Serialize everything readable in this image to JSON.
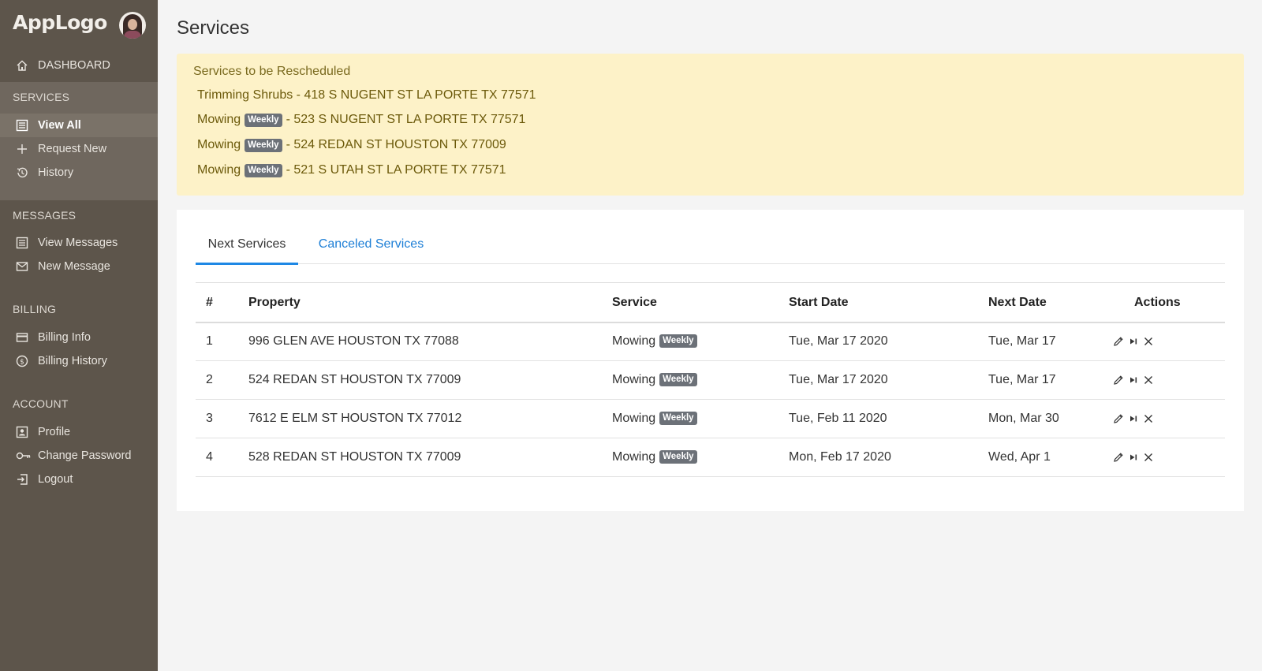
{
  "app": {
    "logo_text": "AppLogo"
  },
  "sidebar": {
    "dashboard": {
      "label": "DASHBOARD",
      "icon": "home-icon"
    },
    "sections": [
      {
        "title": "SERVICES",
        "items": [
          {
            "label": "View All",
            "icon": "list-icon",
            "active": true
          },
          {
            "label": "Request New",
            "icon": "plus-icon"
          },
          {
            "label": "History",
            "icon": "history-icon"
          }
        ]
      },
      {
        "title": "MESSAGES",
        "items": [
          {
            "label": "View Messages",
            "icon": "list-icon"
          },
          {
            "label": "New Message",
            "icon": "mail-icon"
          }
        ]
      },
      {
        "title": "BILLING",
        "items": [
          {
            "label": "Billing Info",
            "icon": "card-icon"
          },
          {
            "label": "Billing History",
            "icon": "dollar-icon"
          }
        ]
      },
      {
        "title": "ACCOUNT",
        "items": [
          {
            "label": "Profile",
            "icon": "profile-icon"
          },
          {
            "label": "Change Password",
            "icon": "key-icon"
          },
          {
            "label": "Logout",
            "icon": "logout-icon"
          }
        ]
      }
    ]
  },
  "main": {
    "title": "Services",
    "alert": {
      "heading": "Services to be Rescheduled",
      "items": [
        {
          "service": "Trimming Shrubs",
          "badge": "",
          "address": "418 S NUGENT ST LA PORTE TX 77571"
        },
        {
          "service": "Mowing",
          "badge": "Weekly",
          "address": "523 S NUGENT ST LA PORTE TX 77571"
        },
        {
          "service": "Mowing",
          "badge": "Weekly",
          "address": "524 REDAN ST HOUSTON TX 77009"
        },
        {
          "service": "Mowing",
          "badge": "Weekly",
          "address": "521 S UTAH ST LA PORTE TX 77571"
        }
      ]
    },
    "tabs": [
      {
        "label": "Next Services",
        "active": true
      },
      {
        "label": "Canceled Services",
        "active": false
      }
    ],
    "table": {
      "headers": [
        "#",
        "Property",
        "Service",
        "Start Date",
        "Next Date",
        "Actions"
      ],
      "rows": [
        {
          "num": "1",
          "property": "996 GLEN AVE HOUSTON TX 77088",
          "service": "Mowing",
          "badge": "Weekly",
          "start": "Tue, Mar 17 2020",
          "next": "Tue, Mar 17"
        },
        {
          "num": "2",
          "property": "524 REDAN ST HOUSTON TX 77009",
          "service": "Mowing",
          "badge": "Weekly",
          "start": "Tue, Mar 17 2020",
          "next": "Tue, Mar 17"
        },
        {
          "num": "3",
          "property": "7612 E ELM ST HOUSTON TX 77012",
          "service": "Mowing",
          "badge": "Weekly",
          "start": "Tue, Feb 11 2020",
          "next": "Mon, Mar 30"
        },
        {
          "num": "4",
          "property": "528 REDAN ST HOUSTON TX 77009",
          "service": "Mowing",
          "badge": "Weekly",
          "start": "Mon, Feb 17 2020",
          "next": "Wed, Apr 1"
        }
      ],
      "action_icons": [
        "edit-icon",
        "skip-icon",
        "cancel-icon"
      ]
    }
  },
  "colors": {
    "sidebar": "#5d554b",
    "alert_bg": "#fdf2c8",
    "accent": "#1e88e5",
    "badge": "#6c7178"
  }
}
